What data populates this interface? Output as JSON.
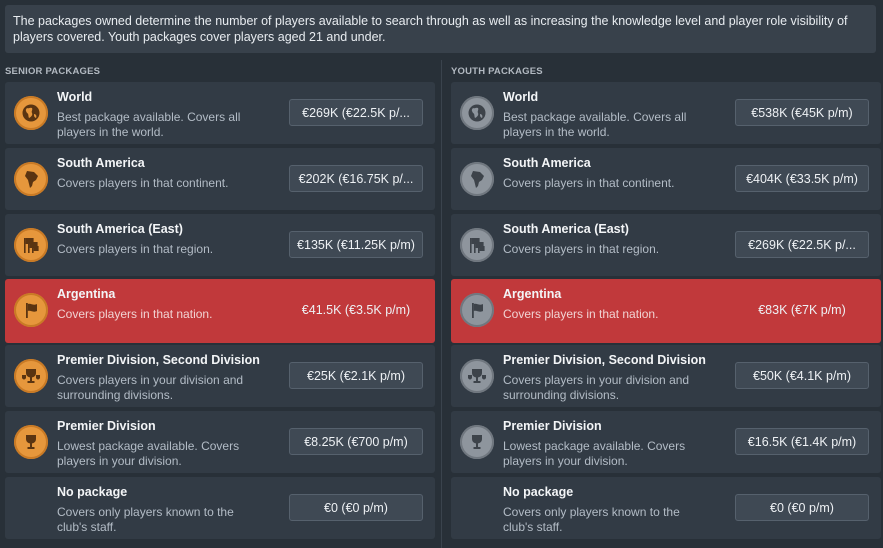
{
  "intro": "The packages owned determine the number of players available to search through as well as increasing the knowledge level and player role visibility of players covered. Youth packages cover players aged 21 and under.",
  "senior": {
    "title": "SENIOR PACKAGES",
    "items": [
      {
        "name": "World",
        "desc": "Best package available. Covers all players in the world.",
        "price": "€269K (€22.5K p/...",
        "icon": "globe-icon"
      },
      {
        "name": "South America",
        "desc": "Covers players in that continent.",
        "price": "€202K (€16.75K p/...",
        "icon": "continent-icon"
      },
      {
        "name": "South America (East)",
        "desc": "Covers players in that region.",
        "price": "€135K (€11.25K p/m)",
        "icon": "flags-icon"
      },
      {
        "name": "Argentina",
        "desc": "Covers players in that nation.",
        "price": "€41.5K (€3.5K p/m)",
        "icon": "flag-icon"
      },
      {
        "name": "Premier Division, Second Division",
        "desc": "Covers players in your division and surrounding divisions.",
        "price": "€25K (€2.1K p/m)",
        "icon": "trophies-icon"
      },
      {
        "name": "Premier Division",
        "desc": "Lowest package available. Covers players in your division.",
        "price": "€8.25K (€700 p/m)",
        "icon": "trophy-icon"
      },
      {
        "name": "No package",
        "desc": "Covers only players known to the club's staff.",
        "price": "€0 (€0 p/m)",
        "icon": ""
      }
    ]
  },
  "youth": {
    "title": "YOUTH PACKAGES",
    "items": [
      {
        "name": "World",
        "desc": "Best package available. Covers all players in the world.",
        "price": "€538K (€45K p/m)",
        "icon": "globe-icon"
      },
      {
        "name": "South America",
        "desc": "Covers players in that continent.",
        "price": "€404K (€33.5K p/m)",
        "icon": "continent-icon"
      },
      {
        "name": "South America (East)",
        "desc": "Covers players in that region.",
        "price": "€269K (€22.5K p/...",
        "icon": "flags-icon"
      },
      {
        "name": "Argentina",
        "desc": "Covers players in that nation.",
        "price": "€83K (€7K p/m)",
        "icon": "flag-icon"
      },
      {
        "name": "Premier Division, Second Division",
        "desc": "Covers players in your division and surrounding divisions.",
        "price": "€50K (€4.1K p/m)",
        "icon": "trophies-icon"
      },
      {
        "name": "Premier Division",
        "desc": "Lowest package available. Covers players in your division.",
        "price": "€16.5K (€1.4K p/m)",
        "icon": "trophy-icon"
      },
      {
        "name": "No package",
        "desc": "Covers only players known to the club's staff.",
        "price": "€0 (€0 p/m)",
        "icon": ""
      }
    ]
  },
  "selected_index": 3,
  "colors": {
    "selected": "#c1393b",
    "senior_badge": "#e6973c",
    "youth_badge": "#8e959d"
  }
}
